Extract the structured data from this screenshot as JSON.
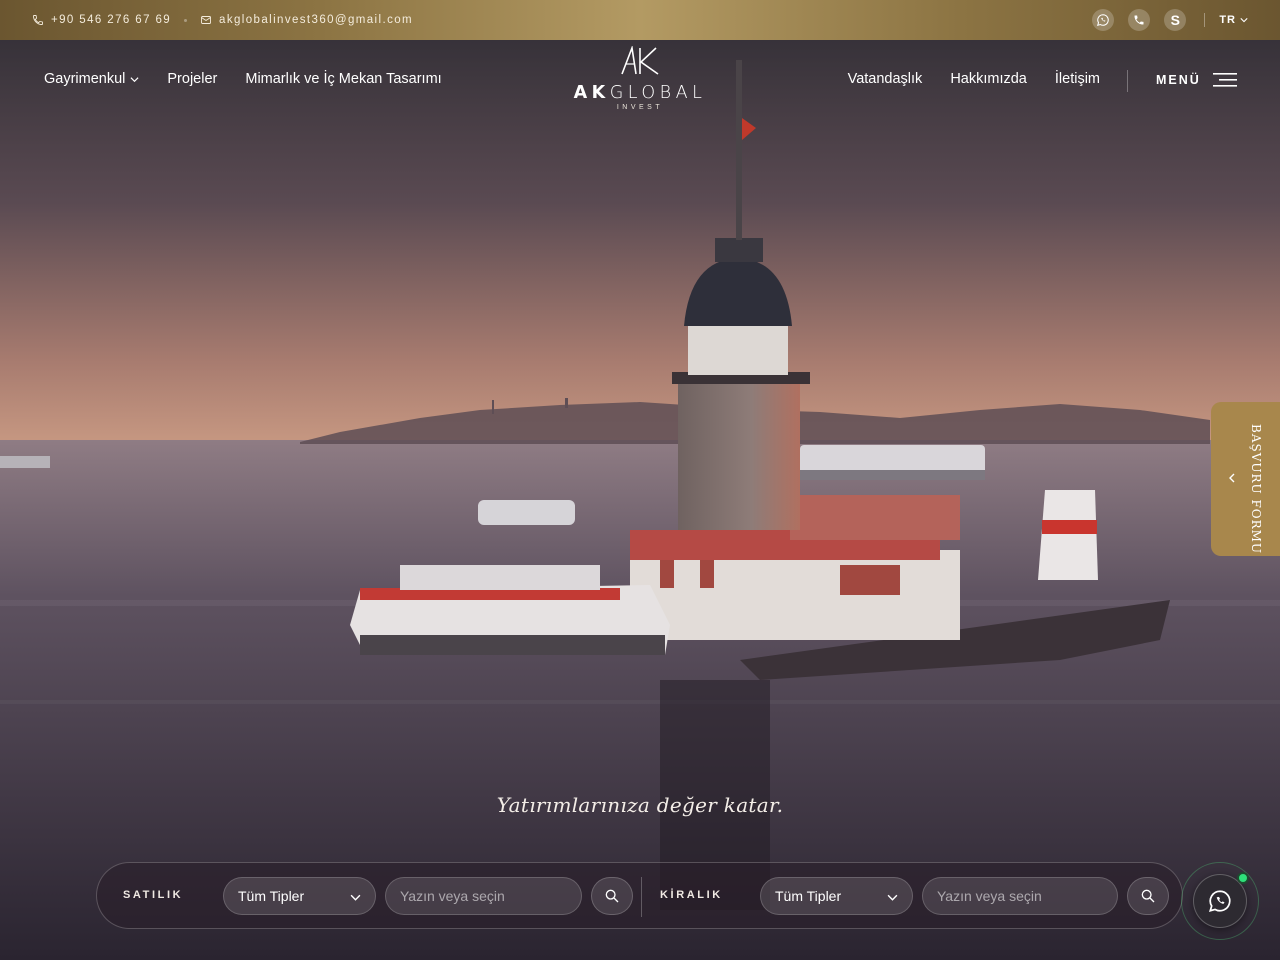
{
  "topbar": {
    "phone": "+90 546 276 67 69",
    "email": "akglobalinvest360@gmail.com",
    "social_icons": [
      "whatsapp-icon",
      "phone-icon",
      "skype-icon"
    ],
    "skype_letter": "S",
    "language": "TR"
  },
  "nav": {
    "left": [
      "Gayrimenkul",
      "Projeler",
      "Mimarlık ve İç Mekan Tasarımı"
    ],
    "right": [
      "Vatandaşlık",
      "Hakkımızda",
      "İletişim"
    ],
    "menu_label": "MENÜ"
  },
  "logo": {
    "monogram": "AK",
    "word_bold": "AK",
    "word_light": "GLOBAL",
    "subtitle": "INVEST"
  },
  "sidetab": {
    "label": "BAŞVURU FORMU"
  },
  "tagline": "Yatırımlarınıza değer katar.",
  "search": {
    "sale": {
      "label": "SATILIK",
      "type_value": "Tüm Tipler",
      "placeholder": "Yazın veya seçin"
    },
    "rent": {
      "label": "KİRALIK",
      "type_value": "Tüm Tipler",
      "placeholder": "Yazın veya seçin"
    }
  },
  "colors": {
    "gold": "#a8874c",
    "whatsapp_badge": "#2ee07a"
  }
}
